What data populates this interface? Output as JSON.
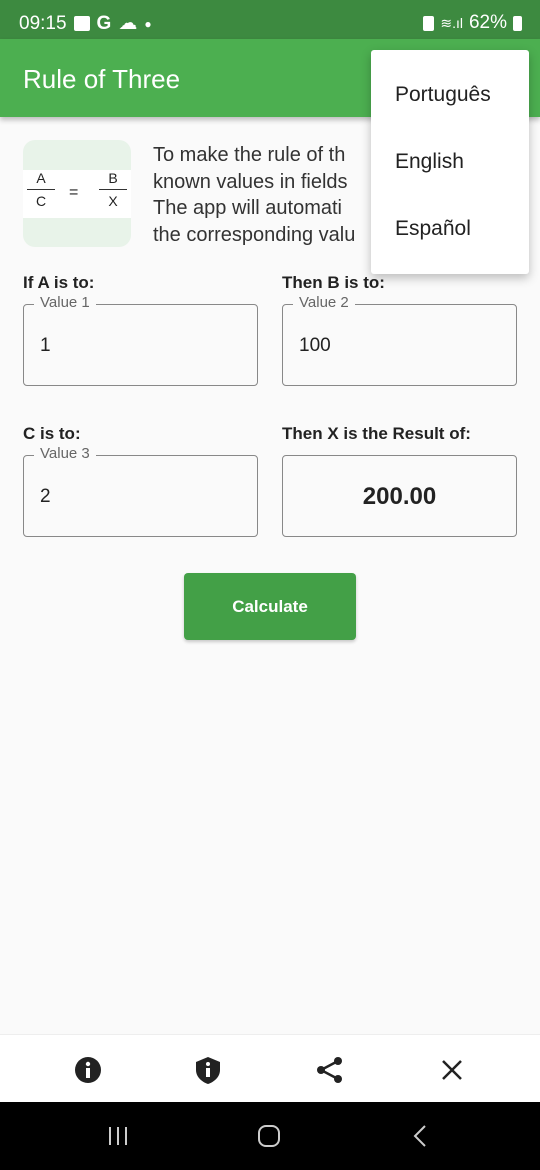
{
  "status_bar": {
    "time": "09:15",
    "battery": "62%"
  },
  "app_bar": {
    "title": "Rule of Three"
  },
  "illustration": {
    "a": "A",
    "b": "B",
    "c": "C",
    "x": "X",
    "equals": "="
  },
  "description_lines": [
    "To make the rule of th",
    "known values in fields",
    "The app will automati",
    "the corresponding valu"
  ],
  "form": {
    "a_label": "If A is to:",
    "a_hint": "Value 1",
    "a_value": "1",
    "b_label": "Then B is to:",
    "b_hint": "Value 2",
    "b_value": "100",
    "c_label": "C is to:",
    "c_hint": "Value 3",
    "c_value": "2",
    "x_label": "Then X is the Result of:",
    "x_value": "200.00"
  },
  "calculate_label": "Calculate",
  "language_menu": {
    "items": [
      "Português",
      "English",
      "Español"
    ]
  },
  "bottom_icons": [
    "info-icon",
    "privacy-shield-icon",
    "share-icon",
    "close-icon"
  ],
  "colors": {
    "primary": "#4caf50",
    "status_bar": "#3d8a40",
    "button": "#43a047"
  }
}
